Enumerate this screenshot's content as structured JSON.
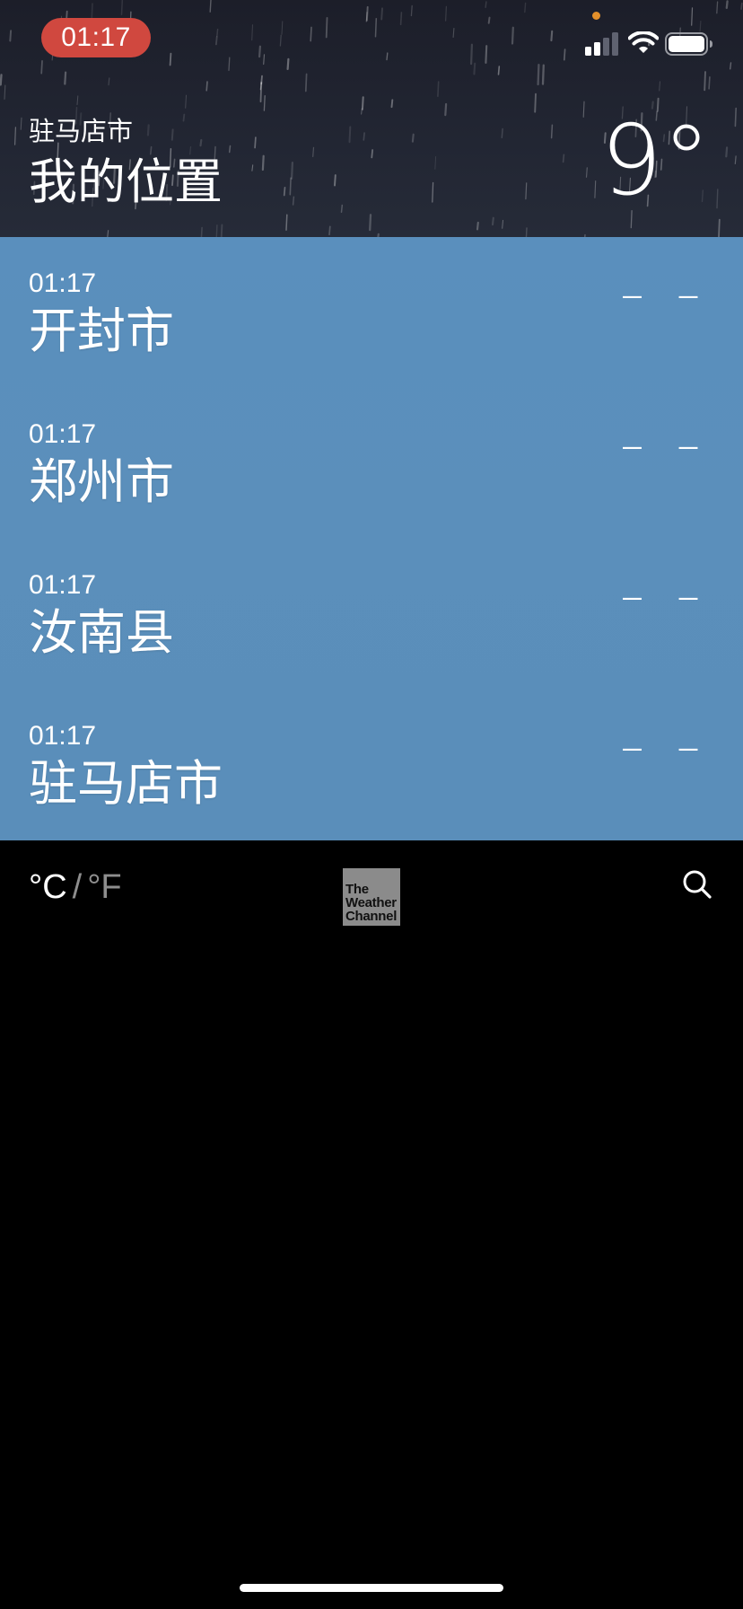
{
  "status_bar": {
    "time": "01:17",
    "icons": [
      "signal-icon",
      "wifi-icon",
      "battery-icon"
    ]
  },
  "current_location": {
    "city": "驻马店市",
    "label": "我的位置",
    "temperature": "9°",
    "background": "rain"
  },
  "cities": [
    {
      "time": "01:17",
      "name": "开封市",
      "temperature": "– –"
    },
    {
      "time": "01:17",
      "name": "郑州市",
      "temperature": "– –"
    },
    {
      "time": "01:17",
      "name": "汝南县",
      "temperature": "– –"
    },
    {
      "time": "01:17",
      "name": "驻马店市",
      "temperature": "– –"
    }
  ],
  "toolbar": {
    "unit_celsius": "°C",
    "unit_separator": "/",
    "unit_fahrenheit": "°F",
    "logo_line1": "The",
    "logo_line2": "Weather",
    "logo_line3": "Channel",
    "search_icon": "search-icon"
  },
  "colors": {
    "time_pill": "#d0483f",
    "list_background": "#5a8fbd",
    "top_background": "#1c1e29",
    "privacy_dot": "#e3902b"
  }
}
